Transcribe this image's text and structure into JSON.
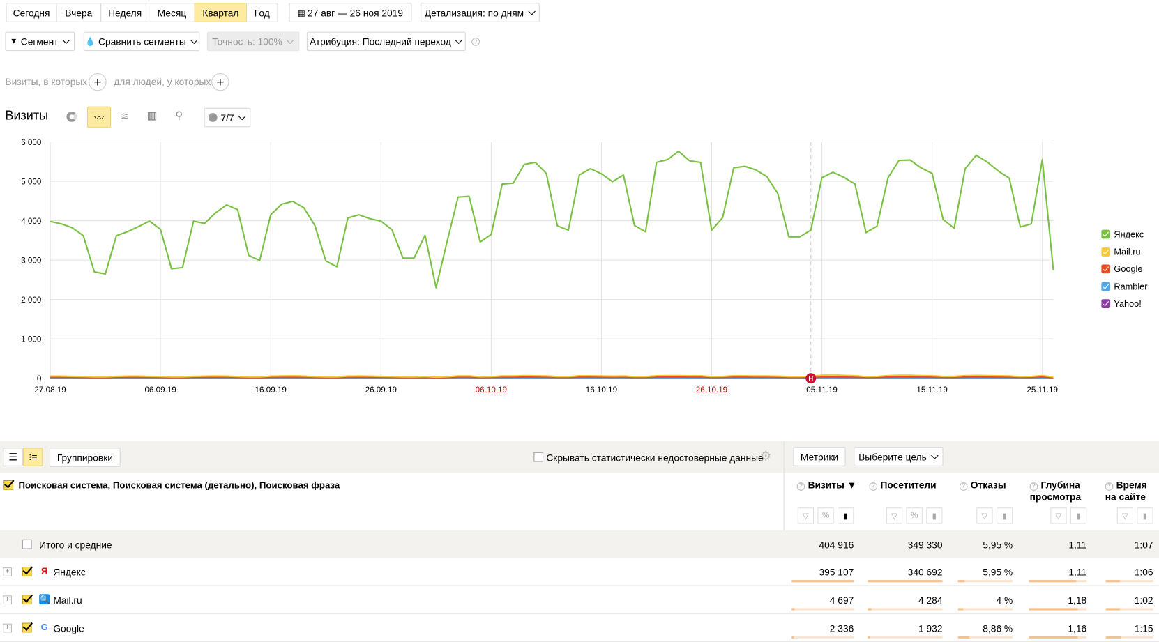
{
  "periods": [
    "Сегодня",
    "Вчера",
    "Неделя",
    "Месяц",
    "Квартал",
    "Год"
  ],
  "active_period": "Квартал",
  "date_range": "27 авг — 26 ноя 2019",
  "detail": "Детализация: по дням",
  "segment": "Сегмент",
  "compare": "Сравнить сегменты",
  "accuracy": "Точность: 100%",
  "attribution": "Атрибуция: Последний переход",
  "filter_visits": "Визиты, в которых",
  "filter_people": "для людей, у которых",
  "chart_title": "Визиты",
  "series_counter": "7/7",
  "chart_data": {
    "type": "line",
    "title": "Визиты",
    "ylim": [
      0,
      6000
    ],
    "yticks": [
      "0",
      "1 000",
      "2 000",
      "3 000",
      "4 000",
      "5 000",
      "6 000"
    ],
    "x_start": "27.08.19",
    "x_end": "26.11.19",
    "xticks": [
      {
        "label": "27.08.19",
        "day": 0,
        "holiday": false
      },
      {
        "label": "06.09.19",
        "day": 10,
        "holiday": false
      },
      {
        "label": "16.09.19",
        "day": 20,
        "holiday": false
      },
      {
        "label": "26.09.19",
        "day": 30,
        "holiday": false
      },
      {
        "label": "06.10.19",
        "day": 40,
        "holiday": true
      },
      {
        "label": "16.10.19",
        "day": 50,
        "holiday": false
      },
      {
        "label": "26.10.19",
        "day": 60,
        "holiday": true
      },
      {
        "label": "05.11.19",
        "day": 70,
        "holiday": false
      },
      {
        "label": "15.11.19",
        "day": 80,
        "holiday": false
      },
      {
        "label": "25.11.19",
        "day": 90,
        "holiday": false
      }
    ],
    "annotation": {
      "label": "Н",
      "day": 69
    },
    "legend_position": "right",
    "series": [
      {
        "name": "Яндекс",
        "color": "#7ac143",
        "values": [
          3980,
          3920,
          3820,
          3620,
          2700,
          2650,
          3620,
          3720,
          3850,
          3990,
          3780,
          2780,
          2810,
          3990,
          3930,
          4200,
          4400,
          4280,
          3120,
          2990,
          4150,
          4420,
          4490,
          4330,
          3880,
          2980,
          2830,
          4070,
          4150,
          4050,
          3990,
          3770,
          3050,
          3050,
          3630,
          2300,
          3470,
          4600,
          4620,
          3460,
          3650,
          4930,
          4950,
          5430,
          5480,
          5200,
          3870,
          3760,
          5160,
          5320,
          5190,
          4990,
          5160,
          3880,
          3720,
          5480,
          5550,
          5760,
          5520,
          5480,
          3760,
          4080,
          5340,
          5380,
          5290,
          5120,
          4690,
          3590,
          3590,
          3760,
          5090,
          5230,
          5100,
          4930,
          3700,
          3860,
          5090,
          5530,
          5540,
          5340,
          5200,
          4030,
          3810,
          5320,
          5660,
          5490,
          5260,
          5080,
          3840,
          3920,
          5550,
          2740
        ]
      },
      {
        "name": "Mail.ru",
        "color": "#f8c832",
        "values": [
          55,
          55,
          50,
          45,
          35,
          35,
          50,
          55,
          55,
          50,
          45,
          35,
          35,
          50,
          55,
          60,
          55,
          45,
          35,
          35,
          55,
          60,
          65,
          55,
          45,
          35,
          35,
          55,
          60,
          55,
          50,
          45,
          35,
          35,
          45,
          30,
          40,
          60,
          60,
          40,
          45,
          60,
          60,
          70,
          65,
          60,
          45,
          45,
          65,
          65,
          60,
          55,
          60,
          45,
          45,
          65,
          70,
          70,
          65,
          65,
          45,
          50,
          65,
          65,
          60,
          60,
          55,
          45,
          45,
          50,
          80,
          90,
          75,
          65,
          45,
          50,
          70,
          80,
          80,
          70,
          65,
          50,
          50,
          70,
          75,
          70,
          65,
          60,
          45,
          50,
          70,
          35
        ]
      },
      {
        "name": "Google",
        "color": "#ef4a23",
        "values": [
          25,
          25,
          24,
          22,
          18,
          18,
          24,
          25,
          25,
          24,
          22,
          18,
          18,
          24,
          25,
          27,
          26,
          22,
          18,
          18,
          25,
          27,
          28,
          25,
          22,
          18,
          18,
          25,
          27,
          25,
          24,
          22,
          18,
          18,
          22,
          15,
          20,
          28,
          28,
          20,
          22,
          30,
          30,
          32,
          32,
          30,
          22,
          22,
          30,
          32,
          30,
          28,
          30,
          22,
          22,
          32,
          33,
          34,
          32,
          32,
          22,
          24,
          32,
          32,
          30,
          30,
          28,
          22,
          22,
          22,
          30,
          32,
          30,
          28,
          22,
          22,
          30,
          33,
          33,
          32,
          30,
          24,
          22,
          32,
          34,
          32,
          30,
          30,
          22,
          22,
          34,
          16
        ]
      },
      {
        "name": "Rambler",
        "color": "#4ea6e6",
        "values": [
          5,
          5,
          5,
          4,
          3,
          3,
          5,
          5,
          5,
          5,
          4,
          3,
          3,
          5,
          5,
          5,
          5,
          4,
          3,
          3,
          5,
          5,
          5,
          5,
          4,
          3,
          3,
          5,
          5,
          5,
          5,
          4,
          3,
          3,
          4,
          3,
          4,
          5,
          5,
          4,
          4,
          6,
          6,
          6,
          6,
          6,
          4,
          4,
          6,
          6,
          6,
          5,
          6,
          4,
          4,
          6,
          6,
          6,
          6,
          6,
          4,
          5,
          6,
          6,
          6,
          6,
          5,
          4,
          4,
          4,
          6,
          6,
          6,
          5,
          4,
          4,
          6,
          6,
          6,
          6,
          6,
          5,
          4,
          6,
          6,
          6,
          6,
          5,
          4,
          4,
          6,
          3
        ]
      },
      {
        "name": "Yahoo!",
        "color": "#8e3ca6",
        "values": [
          2,
          2,
          2,
          2,
          1,
          1,
          2,
          2,
          2,
          2,
          2,
          1,
          1,
          2,
          2,
          2,
          2,
          2,
          1,
          1,
          2,
          2,
          2,
          2,
          2,
          1,
          1,
          2,
          2,
          2,
          2,
          2,
          1,
          1,
          2,
          1,
          2,
          2,
          2,
          2,
          2,
          2,
          2,
          2,
          2,
          2,
          2,
          2,
          2,
          2,
          2,
          2,
          2,
          2,
          2,
          2,
          2,
          2,
          2,
          2,
          2,
          2,
          2,
          2,
          2,
          2,
          2,
          1,
          1,
          2,
          2,
          2,
          2,
          2,
          1,
          1,
          2,
          2,
          2,
          2,
          2,
          2,
          1,
          2,
          2,
          2,
          2,
          2,
          1,
          1,
          2,
          1
        ]
      }
    ]
  },
  "table": {
    "groupings": "Группировки",
    "hide_unreliable": "Скрывать статистически недостоверные данные",
    "metrics_button": "Метрики",
    "goal_button": "Выберите цель",
    "dimension_header": "Поисковая система, Поисковая система (детально), Поисковая фраза",
    "columns": [
      "Визиты",
      "Посетители",
      "Отказы",
      "Глубина просмотра",
      "Время на сайте"
    ],
    "col_lines": [
      [
        "Визиты ▼"
      ],
      [
        "Посетители"
      ],
      [
        "Отказы"
      ],
      [
        "Глубина",
        "просмотра"
      ],
      [
        "Время",
        "на сайте"
      ]
    ],
    "totals": {
      "label": "Итого и средние",
      "values": [
        "404 916",
        "349 330",
        "5,95 %",
        "1,11",
        "1:07"
      ]
    },
    "rows": [
      {
        "name": "Яндекс",
        "icon": "yandex",
        "values": [
          "395 107",
          "340 692",
          "5,95 %",
          "1,11",
          "1:06"
        ],
        "fill": [
          1.0,
          1.0,
          0.12,
          0.82,
          0.3
        ]
      },
      {
        "name": "Mail.ru",
        "icon": "mailru",
        "values": [
          "4 697",
          "4 284",
          "4 %",
          "1,18",
          "1:02"
        ],
        "fill": [
          0.05,
          0.05,
          0.1,
          0.85,
          0.3
        ]
      },
      {
        "name": "Google",
        "icon": "google",
        "values": [
          "2 336",
          "1 932",
          "8,86 %",
          "1,16",
          "1:15"
        ],
        "fill": [
          0.03,
          0.03,
          0.2,
          0.84,
          0.33
        ]
      }
    ]
  }
}
